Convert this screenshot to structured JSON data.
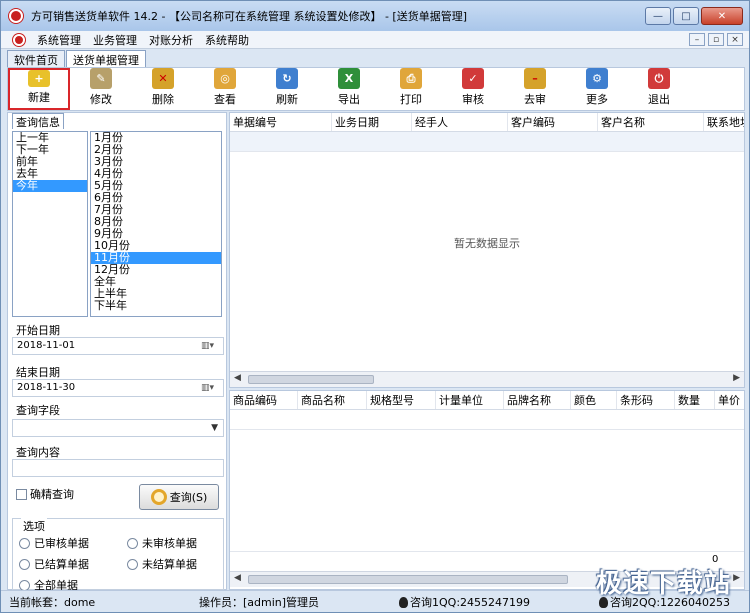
{
  "window": {
    "title": "方可销售送货单软件 14.2 - 【公司名称可在系统管理 系统设置处修改】 - [送货单据管理]",
    "buttons": [
      "—",
      "□",
      "✕"
    ]
  },
  "menubar": {
    "items": [
      "系统管理",
      "业务管理",
      "对账分析",
      "系统帮助"
    ],
    "mdi_buttons": [
      "–",
      "▫",
      "×"
    ]
  },
  "tabs": [
    "软件首页",
    "送货单据管理"
  ],
  "toolbar": [
    {
      "label": "新建",
      "icon": "new-doc-icon",
      "color": "#e8c12a",
      "selected": true
    },
    {
      "label": "修改",
      "icon": "edit-icon",
      "color": "#b7a06a"
    },
    {
      "label": "删除",
      "icon": "delete-icon",
      "color": "#d5a22a"
    },
    {
      "label": "查看",
      "icon": "view-icon",
      "color": "#e0a63a"
    },
    {
      "label": "刷新",
      "icon": "refresh-icon",
      "color": "#3f7fcf"
    },
    {
      "label": "导出",
      "icon": "excel-icon",
      "color": "#2f8f3a"
    },
    {
      "label": "打印",
      "icon": "print-icon",
      "color": "#e0a63a"
    },
    {
      "label": "审核",
      "icon": "audit-icon",
      "color": "#d13a3a"
    },
    {
      "label": "去审",
      "icon": "unaudit-icon",
      "color": "#d5a22a"
    },
    {
      "label": "更多",
      "icon": "more-icon",
      "color": "#3f7fcf"
    },
    {
      "label": "退出",
      "icon": "exit-icon",
      "color": "#d13a3a"
    }
  ],
  "leftpanel": {
    "tab": "查询信息",
    "years": [
      "上一年",
      "下一年",
      "前年",
      "去年",
      "今年"
    ],
    "years_selected": "今年",
    "months": [
      "1月份",
      "2月份",
      "3月份",
      "4月份",
      "5月份",
      "6月份",
      "7月份",
      "8月份",
      "9月份",
      "10月份",
      "11月份",
      "12月份",
      "全年",
      "上半年",
      "下半年"
    ],
    "months_selected": "11月份",
    "start_label": "开始日期",
    "start_value": "2018-11-01",
    "end_label": "结束日期",
    "end_value": "2018-11-30",
    "field_label": "查询字段",
    "field_value": "",
    "content_label": "查询内容",
    "content_value": "",
    "exact_label": "确精查询",
    "query_button": "查询(S)",
    "options_title": "选项",
    "options": [
      "已审核单据",
      "未审核单据",
      "已结算单据",
      "未结算单据",
      "全部单据"
    ]
  },
  "grid_top": {
    "columns": [
      "单据编号",
      "业务日期",
      "经手人",
      "客户编码",
      "客户名称",
      "联系地址"
    ],
    "empty_text": "暂无数据显示"
  },
  "grid_bottom": {
    "columns": [
      "商品编码",
      "商品名称",
      "规格型号",
      "计量单位",
      "品牌名称",
      "颜色",
      "条形码",
      "数量",
      "单价"
    ],
    "total": "0"
  },
  "statusbar": {
    "account": "当前帐套：dome",
    "operator": "操作员：[admin]管理员",
    "qq1": "咨询1QQ:2455247199",
    "qq2": "咨询2QQ:1226040253"
  },
  "watermark": "极速下载站"
}
